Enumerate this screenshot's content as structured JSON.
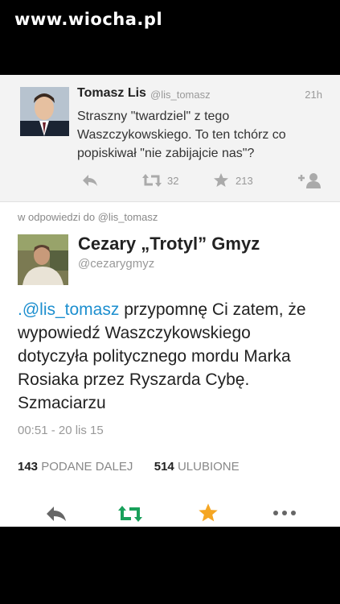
{
  "watermark": "www.wiocha.pl",
  "tweet1": {
    "name": "Tomasz Lis",
    "handle": "@lis_tomasz",
    "time": "21h",
    "lines": [
      "Straszny \"twardziel\" z tego",
      "Waszczykowskiego. To ten tchórz co",
      "popiskiwał \"nie zabijajcie nas\"?"
    ],
    "retweets": "32",
    "favorites": "213"
  },
  "reply_context": "w odpowiedzi do @lis_tomasz",
  "tweet2": {
    "name": "Cezary „Trotyl” Gmyz",
    "handle": "@cezarygmyz",
    "mention": ".@lis_tomasz",
    "line1_rest": " przypomnę Ci zatem, że",
    "lines": [
      "wypowiedź Waszczykowskiego",
      "dotyczyła politycznego mordu Marka",
      "Rosiaka przez Ryszarda Cybę.",
      "Szmaciarzu"
    ],
    "timestamp": "00:51 - 20 lis 15",
    "retweet_count": "143",
    "retweet_label": "PODANE DALEJ",
    "favorite_count": "514",
    "favorite_label": "ULUBIONE"
  },
  "colors": {
    "retweet_green": "#19a05b",
    "favorite_gold": "#f5a623",
    "link_blue": "#1d8fcf"
  },
  "icons": [
    "reply-icon",
    "retweet-icon",
    "star-icon",
    "follow-icon",
    "more-icon"
  ]
}
